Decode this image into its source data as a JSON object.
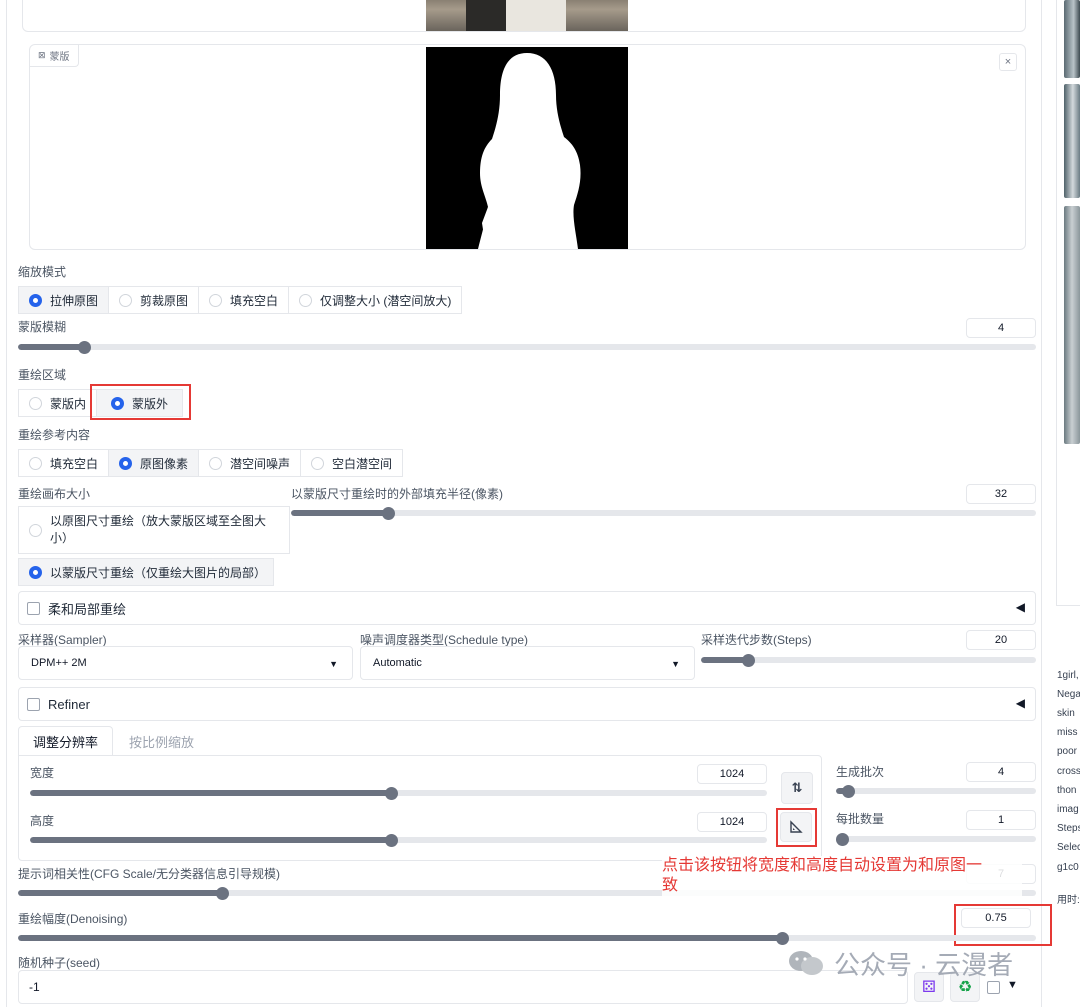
{
  "image_panel": {
    "mask_label": "蒙版",
    "close_glyph": "×"
  },
  "resize_mode": {
    "label": "缩放模式",
    "options": [
      "拉伸原图",
      "剪裁原图",
      "填充空白",
      "仅调整大小 (潜空间放大)"
    ],
    "selected": 0
  },
  "mask_blur": {
    "label": "蒙版模糊",
    "value": "4",
    "fraction": 0.065
  },
  "mask_mode": {
    "label": "重绘区域",
    "options": [
      "蒙版内",
      "蒙版外"
    ],
    "selected": 1
  },
  "masked_content": {
    "label": "重绘参考内容",
    "options": [
      "填充空白",
      "原图像素",
      "潜空间噪声",
      "空白潜空间"
    ],
    "selected": 1
  },
  "inpaint_area": {
    "label": "重绘画布大小",
    "options": [
      "以原图尺寸重绘（放大蒙版区域至全图大小）",
      "以蒙版尺寸重绘（仅重绘大图片的局部）"
    ],
    "selected": 1
  },
  "padding": {
    "label": "以蒙版尺寸重绘时的外部填充半径(像素)",
    "value": "32",
    "fraction": 0.13
  },
  "soft_inpaint": {
    "label": "柔和局部重绘",
    "arrow": "◀"
  },
  "sampler": {
    "label": "采样器(Sampler)",
    "value": "DPM++ 2M",
    "caret": "▼"
  },
  "schedule": {
    "label": "噪声调度器类型(Schedule type)",
    "value": "Automatic",
    "caret": "▼"
  },
  "steps": {
    "label": "采样迭代步数(Steps)",
    "value": "20",
    "fraction": 0.14
  },
  "refiner": {
    "label": "Refiner",
    "arrow": "◀"
  },
  "tabs": [
    "调整分辨率",
    "按比例缩放"
  ],
  "width": {
    "label": "宽度",
    "value": "1024",
    "fraction": 0.49
  },
  "height": {
    "label": "高度",
    "value": "1024",
    "fraction": 0.49
  },
  "swap_icon": "⇅",
  "batch_count": {
    "label": "生成批次",
    "value": "4",
    "fraction": 0.06
  },
  "batch_size": {
    "label": "每批数量",
    "value": "1",
    "fraction": 0.0
  },
  "cfg": {
    "label": "提示词相关性(CFG Scale/无分类器信息引导规模)",
    "value": "7",
    "fraction": 0.2
  },
  "denoising": {
    "label": "重绘幅度(Denoising)",
    "value": "0.75",
    "fraction": 0.75
  },
  "seed": {
    "label": "随机种子(seed)",
    "value": "-1"
  },
  "seed_icons": {
    "dice": "⚄",
    "recycle": "♻",
    "more": "▼"
  },
  "annotation_lines": [
    "点击该按钮将宽度和高度自动设置为和原图一",
    "致"
  ],
  "side_info": [
    "1girl,",
    "Nega",
    "skin",
    "miss",
    "poor",
    "cross",
    "thon",
    "imag",
    "Steps",
    "Selec",
    "g1c0",
    "用时:"
  ],
  "watermark": "公众号 · 云漫者",
  "colors": {
    "accent": "#2563eb",
    "annotation": "#e53935",
    "slider": "#6b7280"
  }
}
